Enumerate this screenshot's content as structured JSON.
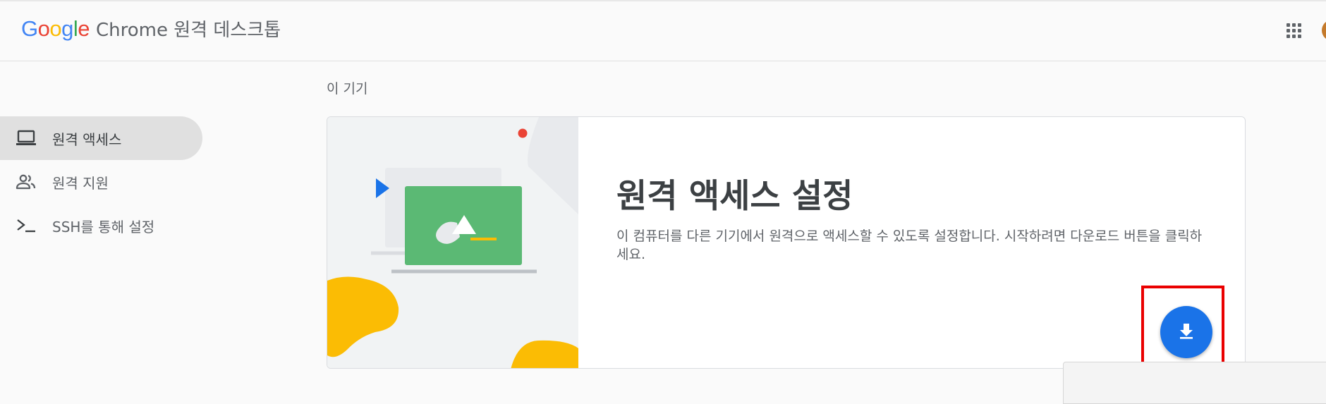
{
  "header": {
    "logo": {
      "letters": [
        {
          "char": "G",
          "color": "#4285f4"
        },
        {
          "char": "o",
          "color": "#ea4335"
        },
        {
          "char": "o",
          "color": "#fbbc05"
        },
        {
          "char": "g",
          "color": "#4285f4"
        },
        {
          "char": "l",
          "color": "#34a853"
        },
        {
          "char": "e",
          "color": "#ea4335"
        }
      ]
    },
    "title": "Chrome 원격 데스크톱",
    "apps_icon": "apps-grid-icon",
    "avatar_icon": "account-avatar"
  },
  "sidebar": {
    "items": [
      {
        "label": "원격 액세스",
        "icon": "laptop-icon",
        "active": true
      },
      {
        "label": "원격 지원",
        "icon": "people-icon",
        "active": false
      },
      {
        "label": "SSH를 통해 설정",
        "icon": "terminal-icon",
        "active": false
      }
    ]
  },
  "main": {
    "section_label": "이 기기",
    "card": {
      "title": "원격 액세스 설정",
      "description": "이 컴퓨터를 다른 기기에서 원격으로 액세스할 수 있도록 설정합니다. 시작하려면 다운로드 버튼을 클릭하세요.",
      "download_icon": "download-icon"
    }
  },
  "colors": {
    "accent": "#1a73e8",
    "active_nav_bg": "#e0e0e0",
    "highlight": "#ea0000",
    "illustration_green": "#5bb974",
    "illustration_yellow": "#fbbc04"
  }
}
